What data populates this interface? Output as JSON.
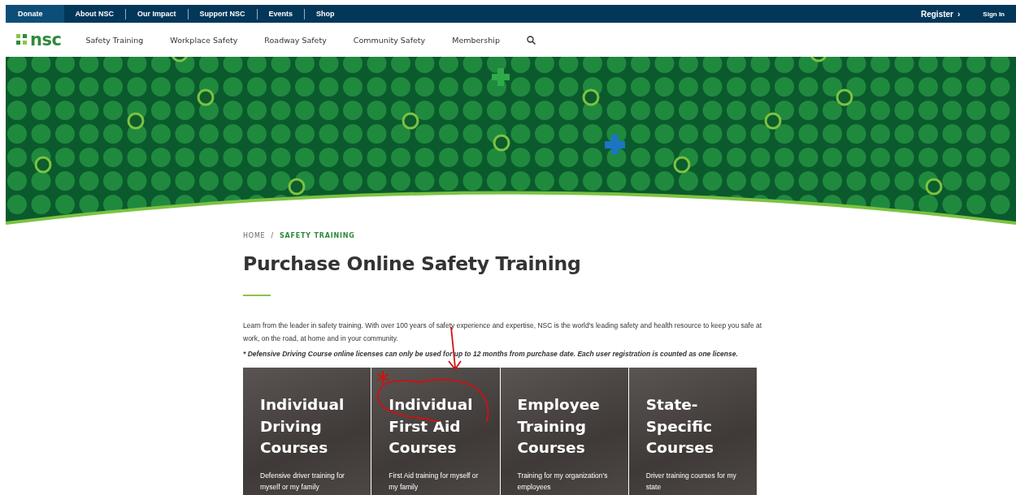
{
  "utility_bar": {
    "links": [
      {
        "label": "Donate",
        "selected": true
      },
      {
        "label": "About NSC",
        "selected": false
      },
      {
        "label": "Our Impact",
        "selected": false
      },
      {
        "label": "Support NSC",
        "selected": false
      },
      {
        "label": "Events",
        "selected": false
      },
      {
        "label": "Shop",
        "selected": false
      }
    ],
    "register": "Register",
    "register_caret": "›",
    "sign_in": "Sign In"
  },
  "main_nav": {
    "logo": "nsc",
    "items": [
      "Safety Training",
      "Workplace Safety",
      "Roadway Safety",
      "Community Safety",
      "Membership"
    ]
  },
  "breadcrumb": [
    {
      "label": "HOME",
      "selected": false
    },
    {
      "label": "SAFETY TRAINING",
      "selected": true
    }
  ],
  "breadcrumb_separator": "/",
  "title": "Purchase Online Safety Training",
  "intro": "Learn from the leader in safety training. With over 100 years of safety experience and expertise, NSC is the world's leading safety and health resource to keep you safe at work, on the road, at home and in your community.",
  "note": "* Defensive Driving Course online licenses can only be used for up to 12 months from purchase date. Each user registration is counted as one license.",
  "cards": [
    {
      "title": "Individual Driving Courses",
      "description": "Defensive driver training for myself or my family"
    },
    {
      "title": "Individual First Aid Courses",
      "description": "First Aid training for myself or my family"
    },
    {
      "title": "Employee Training Courses",
      "description": "Training for my organization's employees"
    },
    {
      "title": "State-Specific Courses",
      "description": "Driver training courses for my state"
    }
  ]
}
